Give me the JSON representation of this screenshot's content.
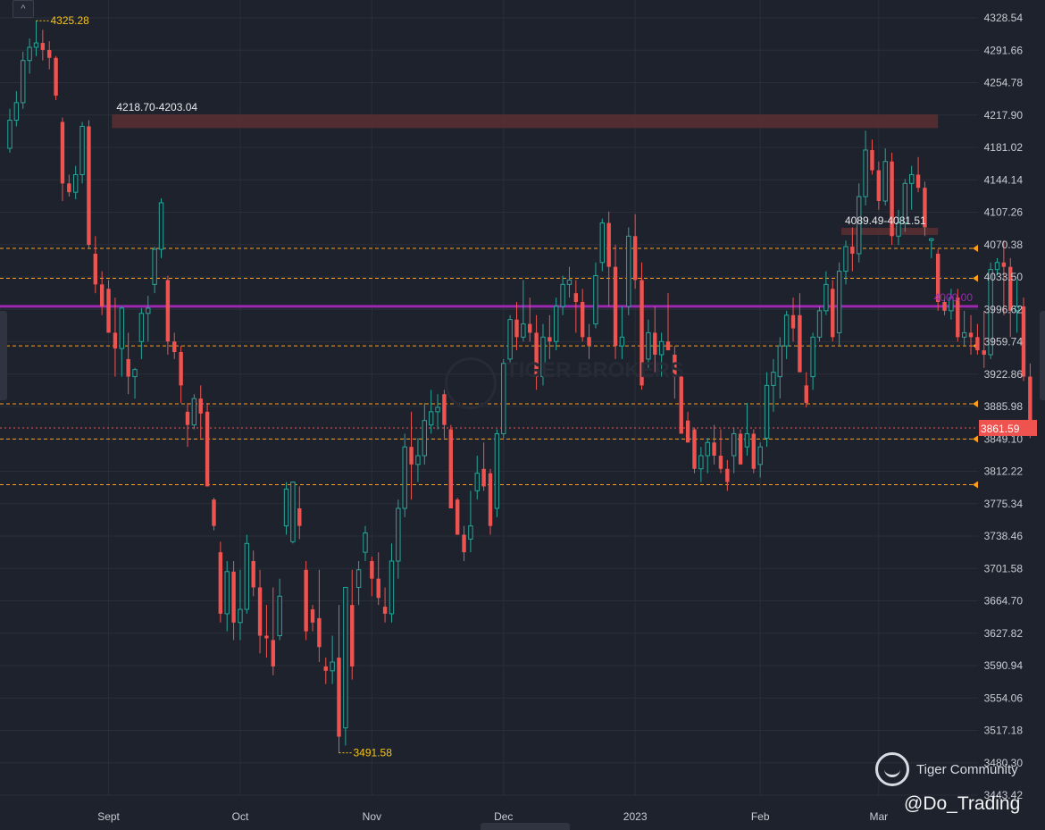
{
  "chart_data": {
    "type": "candlestick",
    "title": "",
    "xlabel": "",
    "ylabel": "",
    "ylim": [
      3443.42,
      4328.54
    ],
    "y_ticks": [
      "4328.54",
      "4291.66",
      "4254.78",
      "4217.90",
      "4181.02",
      "4144.14",
      "4107.26",
      "4070.38",
      "4033.50",
      "3996.62",
      "3959.74",
      "3922.86",
      "3885.98",
      "3849.10",
      "3812.22",
      "3775.34",
      "3738.46",
      "3701.58",
      "3664.70",
      "3627.82",
      "3590.94",
      "3554.06",
      "3517.18",
      "3480.30",
      "3443.42"
    ],
    "x_ticks": [
      "Sept",
      "Oct",
      "Nov",
      "Dec",
      "2023",
      "Feb",
      "Mar"
    ],
    "grid": true,
    "last_price": "3861.59",
    "colors": {
      "up": "#26a69a",
      "down": "#ef5350",
      "background": "#1e222d",
      "grid": "#2a2e39",
      "level_line": "#ff9f1a",
      "key_line": "#9c27b0",
      "label_yellow": "#f5c518",
      "zone": "#5a2f33"
    },
    "annotations": {
      "high_label": "4325.28",
      "low_label": "3491.58",
      "zone_upper_label": "4218.70-4203.04",
      "zone_lower_label": "4089.49-4081.51",
      "key_level_label": "4000.00"
    },
    "horizontal_levels": [
      4066,
      4032,
      3955,
      3889,
      3849,
      3797
    ],
    "key_level": 4000,
    "zones": [
      {
        "from": 4203.04,
        "to": 4218.7,
        "x_start": 9,
        "x_end": 141
      },
      {
        "from": 4081.51,
        "to": 4089.49,
        "x_start": 127,
        "x_end": 141
      }
    ],
    "ohlc": [
      [
        4180,
        4225,
        4175,
        4212
      ],
      [
        4212,
        4245,
        4205,
        4232
      ],
      [
        4232,
        4290,
        4225,
        4280
      ],
      [
        4280,
        4305,
        4265,
        4295
      ],
      [
        4295,
        4325.28,
        4285,
        4300
      ],
      [
        4300,
        4315,
        4280,
        4292
      ],
      [
        4292,
        4302,
        4270,
        4283
      ],
      [
        4283,
        4285,
        4235,
        4240
      ],
      [
        4210,
        4215,
        4120,
        4140
      ],
      [
        4140,
        4150,
        4125,
        4130
      ],
      [
        4130,
        4160,
        4122,
        4150
      ],
      [
        4150,
        4210,
        4140,
        4205
      ],
      [
        4205,
        4212,
        4065,
        4070
      ],
      [
        4060,
        4080,
        4015,
        4025
      ],
      [
        4025,
        4040,
        3990,
        4000
      ],
      [
        4020,
        4030,
        3970,
        3970
      ],
      [
        3970,
        4010,
        3920,
        3952
      ],
      [
        3952,
        4000,
        3920,
        3998
      ],
      [
        3940,
        3970,
        3900,
        3920
      ],
      [
        3920,
        3930,
        3895,
        3928
      ],
      [
        3960,
        3998,
        3940,
        3992
      ],
      [
        3992,
        4012,
        3960,
        3998
      ],
      [
        4025,
        4068,
        4015,
        4065
      ],
      [
        4065,
        4123,
        4055,
        4118
      ],
      [
        4030,
        4035,
        3945,
        3960
      ],
      [
        3960,
        3970,
        3940,
        3948
      ],
      [
        3948,
        3955,
        3890,
        3910
      ],
      [
        3880,
        3890,
        3840,
        3865
      ],
      [
        3865,
        3900,
        3860,
        3895
      ],
      [
        3895,
        3910,
        3850,
        3878
      ],
      [
        3880,
        3890,
        3795,
        3795
      ],
      [
        3780,
        3782,
        3745,
        3750
      ],
      [
        3720,
        3732,
        3640,
        3650
      ],
      [
        3650,
        3710,
        3630,
        3698
      ],
      [
        3698,
        3710,
        3620,
        3640
      ],
      [
        3640,
        3700,
        3620,
        3655
      ],
      [
        3655,
        3740,
        3650,
        3730
      ],
      [
        3710,
        3722,
        3670,
        3680
      ],
      [
        3680,
        3700,
        3605,
        3625
      ],
      [
        3625,
        3660,
        3600,
        3622
      ],
      [
        3620,
        3680,
        3580,
        3590
      ],
      [
        3625,
        3690,
        3620,
        3670
      ],
      [
        3750,
        3800,
        3740,
        3792
      ],
      [
        3732,
        3800,
        3730,
        3800
      ],
      [
        3770,
        3795,
        3735,
        3750
      ],
      [
        3700,
        3710,
        3620,
        3630
      ],
      [
        3655,
        3660,
        3630,
        3640
      ],
      [
        3645,
        3700,
        3595,
        3612
      ],
      [
        3590,
        3600,
        3570,
        3585
      ],
      [
        3585,
        3625,
        3570,
        3595
      ],
      [
        3600,
        3660,
        3491.58,
        3510
      ],
      [
        3520,
        3530,
        3500,
        3680
      ],
      [
        3660,
        3700,
        3575,
        3590
      ],
      [
        3680,
        3710,
        3660,
        3700
      ],
      [
        3720,
        3750,
        3710,
        3742
      ],
      [
        3710,
        3715,
        3670,
        3690
      ],
      [
        3690,
        3720,
        3660,
        3668
      ],
      [
        3658,
        3680,
        3640,
        3650
      ],
      [
        3650,
        3730,
        3640,
        3710
      ],
      [
        3710,
        3780,
        3690,
        3770
      ],
      [
        3770,
        3855,
        3760,
        3840
      ],
      [
        3840,
        3880,
        3780,
        3820
      ],
      [
        3820,
        3850,
        3800,
        3830
      ],
      [
        3830,
        3890,
        3820,
        3870
      ],
      [
        3865,
        3905,
        3855,
        3880
      ],
      [
        3880,
        3900,
        3860,
        3885
      ],
      [
        3900,
        3905,
        3850,
        3865
      ],
      [
        3860,
        3865,
        3795,
        3770
      ],
      [
        3780,
        3782,
        3740,
        3740
      ],
      [
        3740,
        3750,
        3710,
        3720
      ],
      [
        3735,
        3790,
        3720,
        3750
      ],
      [
        3790,
        3830,
        3780,
        3810
      ],
      [
        3815,
        3845,
        3790,
        3795
      ],
      [
        3810,
        3815,
        3740,
        3750
      ],
      [
        3770,
        3860,
        3760,
        3855
      ],
      [
        3855,
        3940,
        3850,
        3935
      ],
      [
        3940,
        3990,
        3935,
        3985
      ],
      [
        3985,
        4005,
        3950,
        3965
      ],
      [
        3965,
        4030,
        3960,
        3980
      ],
      [
        3980,
        4010,
        3960,
        3970
      ],
      [
        3970,
        3990,
        3905,
        3920
      ],
      [
        3920,
        3980,
        3910,
        3965
      ],
      [
        3965,
        3990,
        3940,
        3960
      ],
      [
        3960,
        4010,
        3950,
        4000
      ],
      [
        4000,
        4035,
        3990,
        4025
      ],
      [
        4025,
        4045,
        4010,
        4030
      ],
      [
        4015,
        4030,
        3970,
        4005
      ],
      [
        4005,
        4020,
        3960,
        3965
      ],
      [
        3965,
        3980,
        3940,
        3955
      ],
      [
        3980,
        4050,
        3975,
        4035
      ],
      [
        4050,
        4100,
        4040,
        4095
      ],
      [
        4095,
        4108,
        4000,
        4045
      ],
      [
        4045,
        4070,
        3940,
        3955
      ],
      [
        3955,
        4000,
        3940,
        3965
      ],
      [
        4000,
        4090,
        3990,
        4080
      ],
      [
        4080,
        4105,
        4020,
        4030
      ],
      [
        4030,
        4050,
        3905,
        3910
      ],
      [
        3940,
        3985,
        3930,
        3970
      ],
      [
        3970,
        4000,
        3925,
        3945
      ],
      [
        3945,
        3970,
        3920,
        3960
      ],
      [
        3960,
        4015,
        3955,
        3950
      ],
      [
        3945,
        3955,
        3895,
        3920
      ],
      [
        3920,
        3925,
        3870,
        3855
      ],
      [
        3870,
        3880,
        3845,
        3845
      ],
      [
        3860,
        3862,
        3810,
        3815
      ],
      [
        3815,
        3840,
        3800,
        3830
      ],
      [
        3830,
        3850,
        3810,
        3845
      ],
      [
        3845,
        3865,
        3820,
        3830
      ],
      [
        3830,
        3860,
        3810,
        3815
      ],
      [
        3815,
        3825,
        3790,
        3800
      ],
      [
        3830,
        3862,
        3810,
        3855
      ],
      [
        3855,
        3860,
        3820,
        3820
      ],
      [
        3840,
        3890,
        3830,
        3855
      ],
      [
        3855,
        3860,
        3810,
        3815
      ],
      [
        3820,
        3845,
        3805,
        3840
      ],
      [
        3850,
        3925,
        3840,
        3910
      ],
      [
        3910,
        3940,
        3880,
        3925
      ],
      [
        3920,
        3965,
        3895,
        3955
      ],
      [
        3955,
        3995,
        3940,
        3990
      ],
      [
        3990,
        4010,
        3960,
        3975
      ],
      [
        3990,
        4015,
        3940,
        3925
      ],
      [
        3910,
        3925,
        3885,
        3890
      ],
      [
        3920,
        3970,
        3905,
        3965
      ],
      [
        3965,
        4000,
        3960,
        3995
      ],
      [
        3995,
        4040,
        3990,
        4025
      ],
      [
        4020,
        4030,
        3960,
        3965
      ],
      [
        3970,
        4050,
        3955,
        4040
      ],
      [
        4040,
        4075,
        4025,
        4068
      ],
      [
        4068,
        4090,
        4040,
        4060
      ],
      [
        4060,
        4140,
        4050,
        4125
      ],
      [
        4125,
        4200,
        4115,
        4178
      ],
      [
        4178,
        4190,
        4150,
        4155
      ],
      [
        4155,
        4165,
        4110,
        4120
      ],
      [
        4120,
        4180,
        4115,
        4165
      ],
      [
        4165,
        4175,
        4070,
        4080
      ],
      [
        4080,
        4110,
        4070,
        4095
      ],
      [
        4095,
        4145,
        4085,
        4140
      ],
      [
        4140,
        4160,
        4110,
        4150
      ],
      [
        4150,
        4170,
        4130,
        4135
      ],
      [
        4135,
        4142,
        4080,
        4090
      ],
      [
        4075,
        4078,
        4055,
        4077
      ],
      [
        4060,
        4065,
        3995,
        4005
      ],
      [
        4005,
        4010,
        3990,
        3995
      ],
      [
        3995,
        4020,
        3985,
        4010
      ],
      [
        4010,
        4020,
        3960,
        3965
      ],
      [
        3965,
        3995,
        3955,
        3970
      ],
      [
        3970,
        3990,
        3945,
        3965
      ],
      [
        3965,
        3980,
        3945,
        3950
      ],
      [
        3950,
        3995,
        3930,
        3945
      ],
      [
        3945,
        4050,
        3940,
        4042
      ],
      [
        4042,
        4055,
        4035,
        4050
      ],
      [
        4050,
        4075,
        3990,
        4045
      ],
      [
        4045,
        4055,
        3965,
        3995
      ],
      [
        3995,
        4030,
        3970,
        4000
      ],
      [
        4000,
        4010,
        3915,
        3920
      ],
      [
        3920,
        3935,
        3850,
        3861.59
      ]
    ]
  },
  "watermark": {
    "brand": "Tiger Community",
    "handle": "@Do_Trading",
    "bg_text": "TIGER BROKERS"
  }
}
